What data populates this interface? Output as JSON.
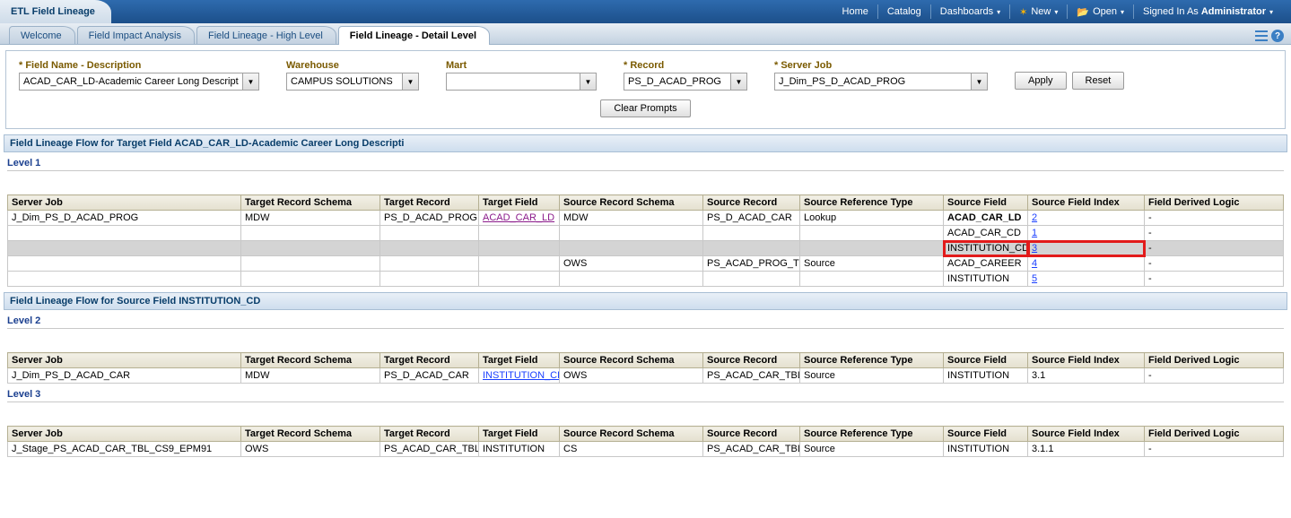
{
  "topbar": {
    "title": "ETL Field Lineage",
    "links": {
      "home": "Home",
      "catalog": "Catalog",
      "dashboards": "Dashboards",
      "new": "New",
      "open": "Open",
      "signed_in": "Signed In As",
      "user": "Administrator"
    }
  },
  "subtabs": [
    "Welcome",
    "Field Impact Analysis",
    "Field Lineage - High Level",
    "Field Lineage - Detail Level"
  ],
  "prompts": {
    "field_name_label": "* Field Name - Description",
    "field_name_value": "ACAD_CAR_LD-Academic Career Long Descripti",
    "warehouse_label": "Warehouse",
    "warehouse_value": "CAMPUS SOLUTIONS",
    "mart_label": "Mart",
    "mart_value": "",
    "record_label": "* Record",
    "record_value": "PS_D_ACAD_PROG",
    "server_job_label": "* Server Job",
    "server_job_value": "J_Dim_PS_D_ACAD_PROG",
    "apply": "Apply",
    "reset": "Reset",
    "clear": "Clear Prompts"
  },
  "section1_title": "Field Lineage Flow for Target Field ACAD_CAR_LD-Academic Career Long Descripti",
  "level1": "Level 1",
  "columns": [
    "Server Job",
    "Target Record Schema",
    "Target Record",
    "Target Field",
    "Source Record Schema",
    "Source Record",
    "Source Reference Type",
    "Source Field",
    "Source Field Index",
    "Field Derived Logic"
  ],
  "t1_rows": [
    {
      "sj": "J_Dim_PS_D_ACAD_PROG",
      "trs": "MDW",
      "tr": "PS_D_ACAD_PROG",
      "tf": "ACAD_CAR_LD",
      "srs": "MDW",
      "sr": "PS_D_ACAD_CAR",
      "srt": "Lookup",
      "sf": "ACAD_CAR_LD",
      "sfi": "2",
      "fdl": "-",
      "bold": true,
      "visited": true
    },
    {
      "sj": "",
      "trs": "",
      "tr": "",
      "tf": "",
      "srs": "",
      "sr": "",
      "srt": "",
      "sf": "ACAD_CAR_CD",
      "sfi": "1",
      "fdl": "-"
    },
    {
      "sj": "",
      "trs": "",
      "tr": "",
      "tf": "",
      "srs": "",
      "sr": "",
      "srt": "",
      "sf": "INSTITUTION_CD",
      "sfi": "3",
      "fdl": "-",
      "hl": true
    },
    {
      "sj": "",
      "trs": "",
      "tr": "",
      "tf": "",
      "srs": "OWS",
      "sr": "PS_ACAD_PROG_TBL",
      "srt": "Source",
      "sf": "ACAD_CAREER",
      "sfi": "4",
      "fdl": "-"
    },
    {
      "sj": "",
      "trs": "",
      "tr": "",
      "tf": "",
      "srs": "",
      "sr": "",
      "srt": "",
      "sf": "INSTITUTION",
      "sfi": "5",
      "fdl": "-"
    }
  ],
  "section2_title": "Field Lineage Flow for Source Field INSTITUTION_CD",
  "level2": "Level 2",
  "t2_rows": [
    {
      "sj": "J_Dim_PS_D_ACAD_CAR",
      "trs": "MDW",
      "tr": "PS_D_ACAD_CAR",
      "tf": "INSTITUTION_CD",
      "srs": "OWS",
      "sr": "PS_ACAD_CAR_TBL",
      "srt": "Source",
      "sf": "INSTITUTION",
      "sfi": "3.1",
      "fdl": "-",
      "link": true
    }
  ],
  "level3": "Level 3",
  "t3_rows": [
    {
      "sj": "J_Stage_PS_ACAD_CAR_TBL_CS9_EPM91",
      "trs": "OWS",
      "tr": "PS_ACAD_CAR_TBL",
      "tf": "INSTITUTION",
      "srs": "CS",
      "sr": "PS_ACAD_CAR_TBL",
      "srt": "Source",
      "sf": "INSTITUTION",
      "sfi": "3.1.1",
      "fdl": "-"
    }
  ]
}
